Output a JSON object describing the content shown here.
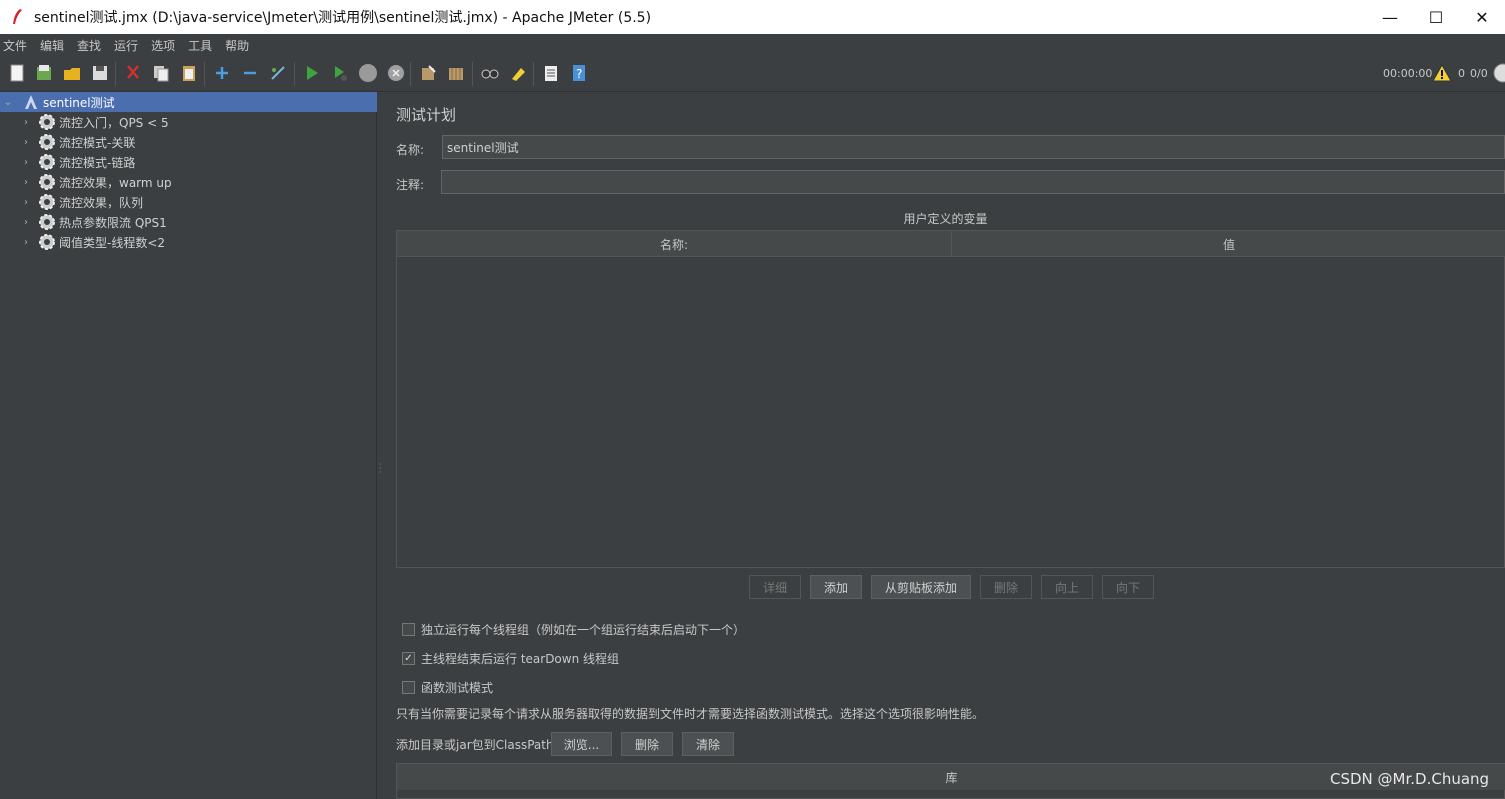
{
  "window": {
    "title": "sentinel测试.jmx (D:\\java-service\\Jmeter\\测试用例\\sentinel测试.jmx) - Apache JMeter (5.5)",
    "minimize": "—",
    "maximize": "☐",
    "close": "✕"
  },
  "menu": [
    "文件",
    "编辑",
    "查找",
    "运行",
    "选项",
    "工具",
    "帮助"
  ],
  "toolbar": {
    "icons": [
      "new-icon",
      "templates-icon",
      "open-icon",
      "save-icon",
      "cut-icon",
      "copy-icon",
      "paste-icon",
      "expand-icon",
      "collapse-icon",
      "toggle-icon",
      "start-icon",
      "start-no-pause-icon",
      "stop-icon",
      "shutdown-icon",
      "clear-icon",
      "clear-all-icon",
      "search-icon",
      "reset-search-icon",
      "function-helper-icon",
      "help-icon"
    ],
    "elapsed": "00:00:00",
    "warnings": "0",
    "threads": "0/0"
  },
  "tree": {
    "root": "sentinel测试",
    "items": [
      "流控入门，QPS < 5",
      "流控模式-关联",
      "流控模式-链路",
      "流控效果，warm up",
      "流控效果，队列",
      "热点参数限流 QPS1",
      "阈值类型-线程数<2"
    ]
  },
  "panel": {
    "title": "测试计划",
    "name_label": "名称:",
    "name_value": "sentinel测试",
    "comment_label": "注释:",
    "comment_value": "",
    "vars_caption": "用户定义的变量",
    "col_name": "名称:",
    "col_value": "值",
    "buttons": {
      "detail": "详细",
      "add": "添加",
      "add_clipboard": "从剪贴板添加",
      "delete": "删除",
      "up": "向上",
      "down": "向下"
    },
    "options": {
      "serialize": "独立运行每个线程组（例如在一个组运行结束后启动下一个）",
      "teardown": "主线程结束后运行 tearDown 线程组",
      "functional": "函数测试模式"
    },
    "functional_note": "只有当你需要记录每个请求从服务器取得的数据到文件时才需要选择函数测试模式。选择这个选项很影响性能。",
    "classpath_label": "添加目录或jar包到ClassPath",
    "classpath_buttons": {
      "browse": "浏览...",
      "delete": "删除",
      "clear": "清除"
    },
    "lib_col": "库"
  },
  "watermark": "CSDN @Mr.D.Chuang",
  "colors": {
    "background": "#3c3f41",
    "selection": "#4b6eaf",
    "field": "#45494a"
  }
}
